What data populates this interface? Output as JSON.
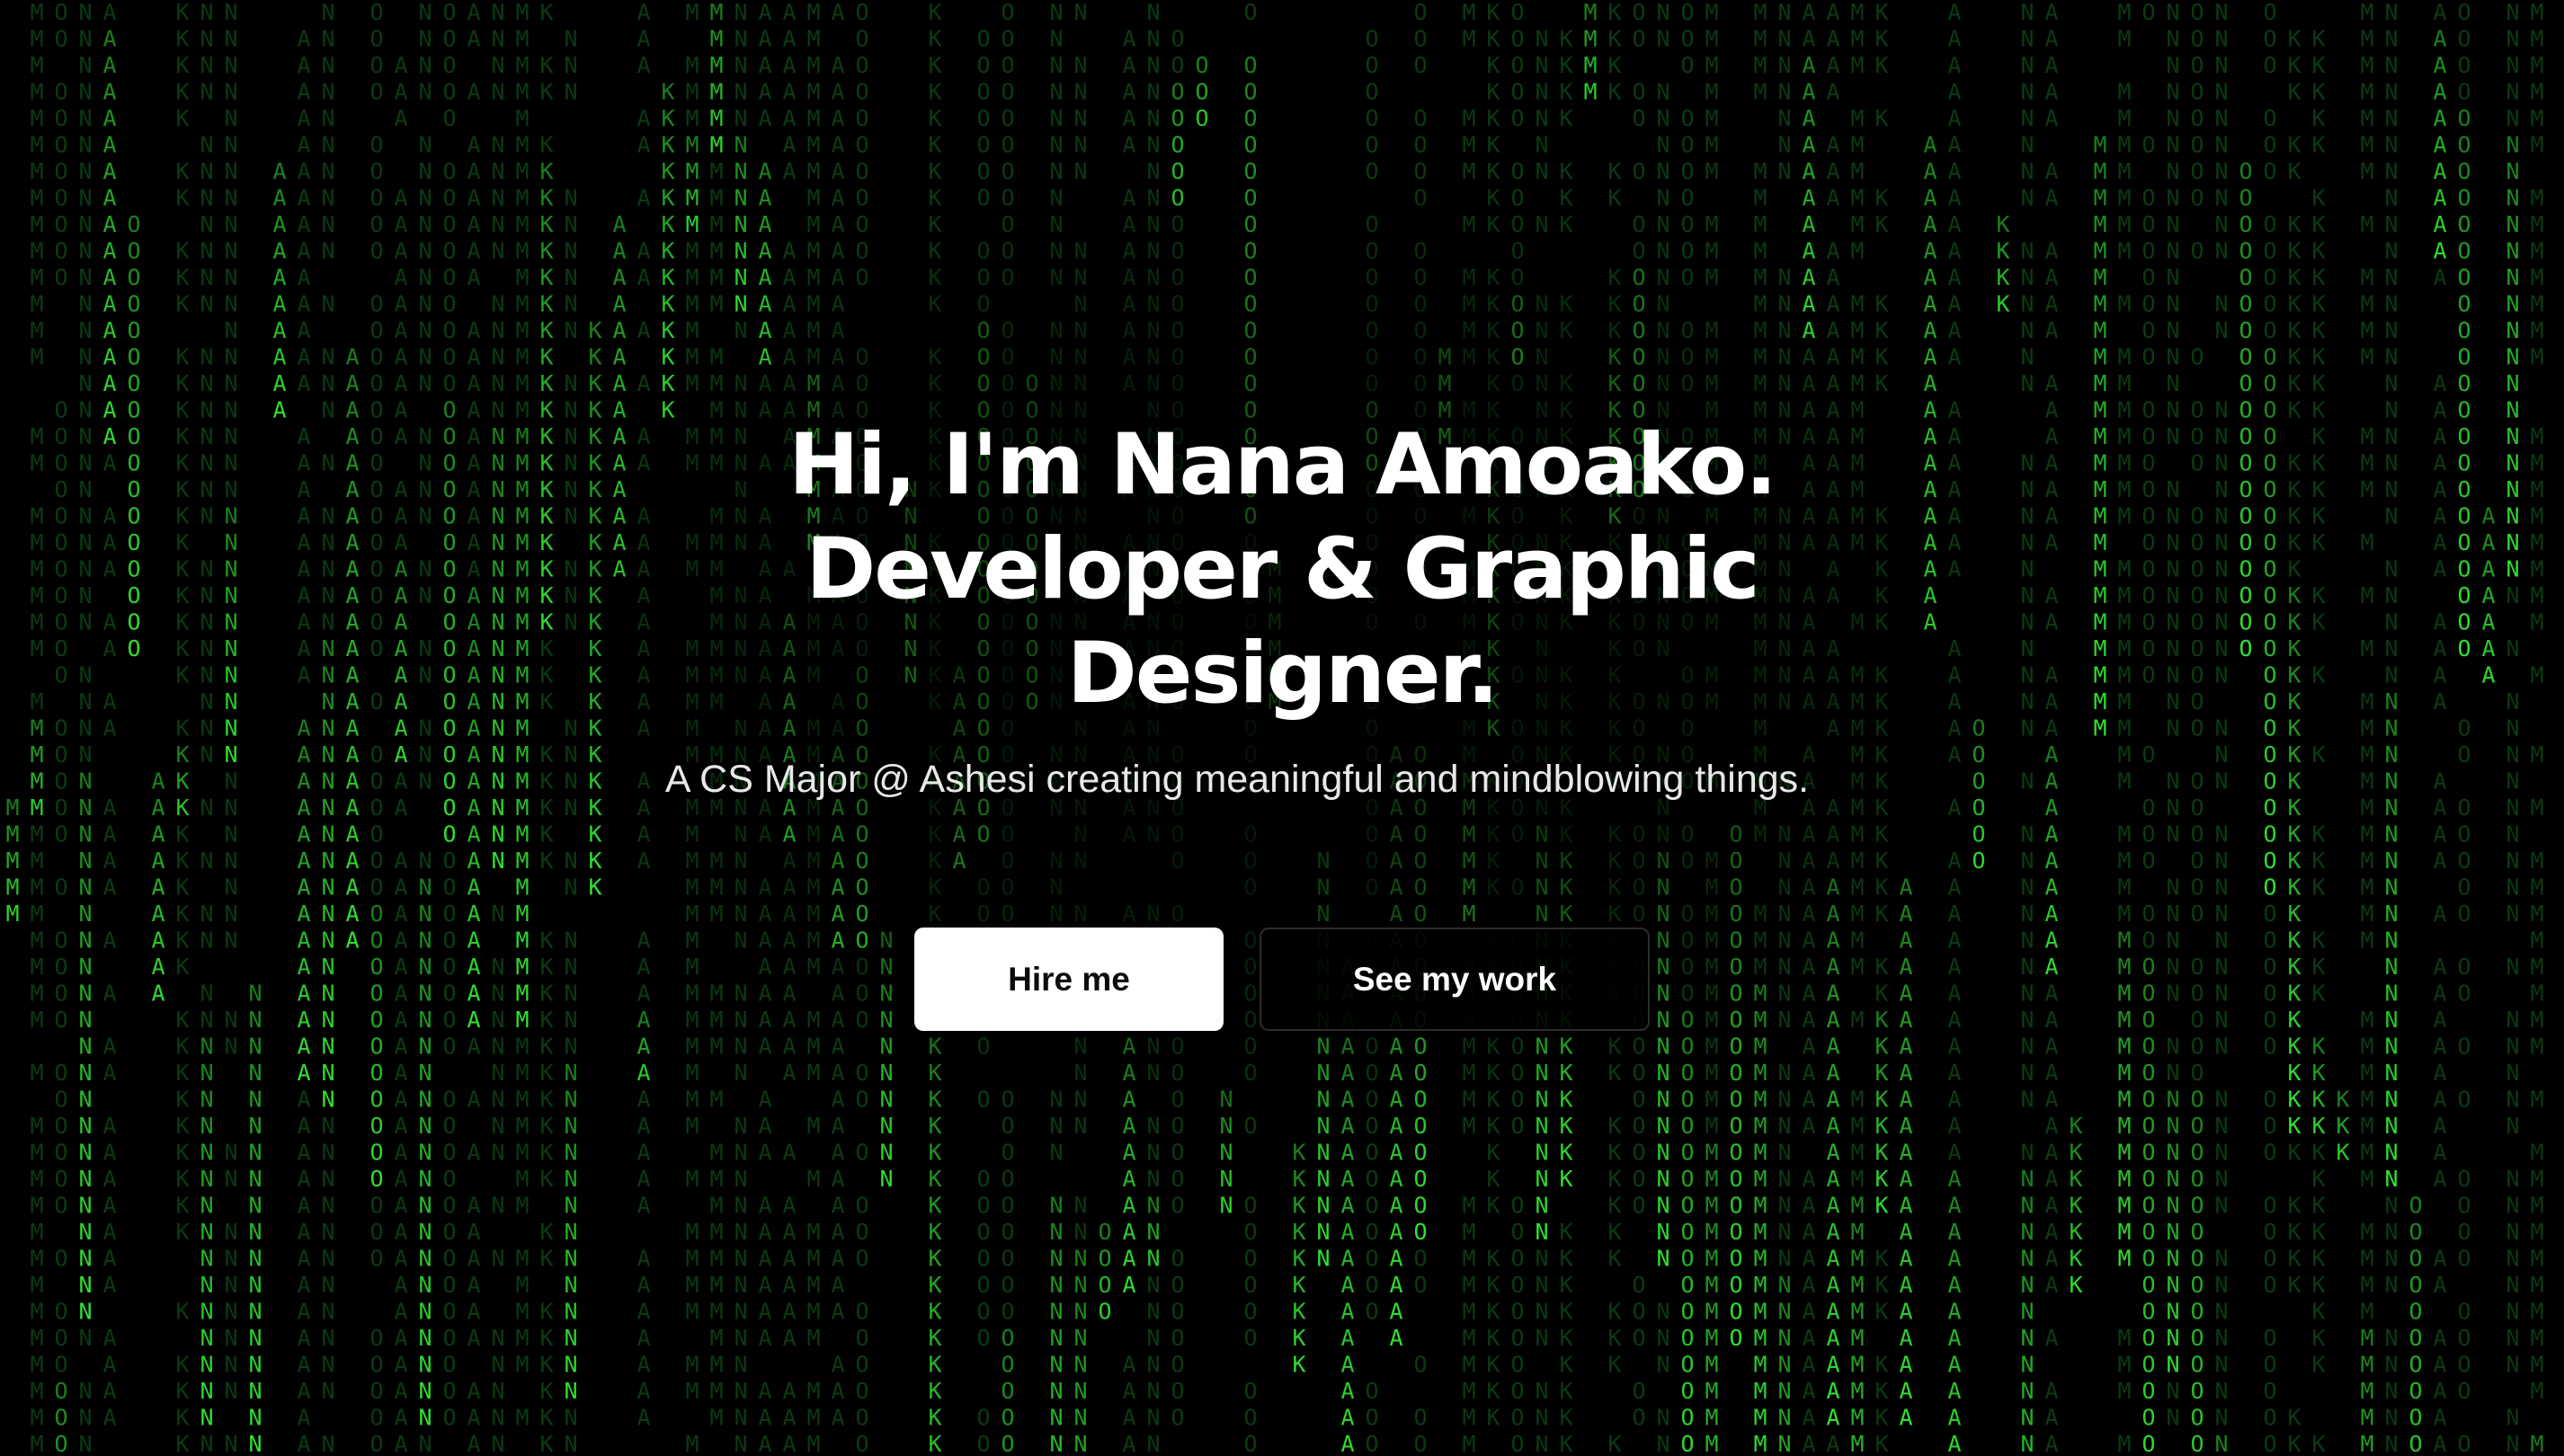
{
  "hero": {
    "headline": {
      "line1": "Hi, I'm Nana Amoako.",
      "line2": "Developer & Graphic",
      "line3": "Designer."
    },
    "subtitle": "A CS Major @ Ashesi creating meaningful and mindblowing things.",
    "primary_button": "Hire me",
    "secondary_button": "See my work"
  },
  "background": {
    "style": "matrix-rain",
    "glyph_set": [
      "N",
      "A",
      "M",
      "O",
      "K"
    ],
    "bright_color": "#32e632",
    "dim_color": "#0b3a12"
  },
  "colors": {
    "page_background": "#000000",
    "headline_text": "#ffffff",
    "subtitle_text": "#e8e8e8",
    "primary_button_bg": "#ffffff",
    "primary_button_text": "#0c0c0c",
    "secondary_button_border": "#2c2c2c"
  }
}
